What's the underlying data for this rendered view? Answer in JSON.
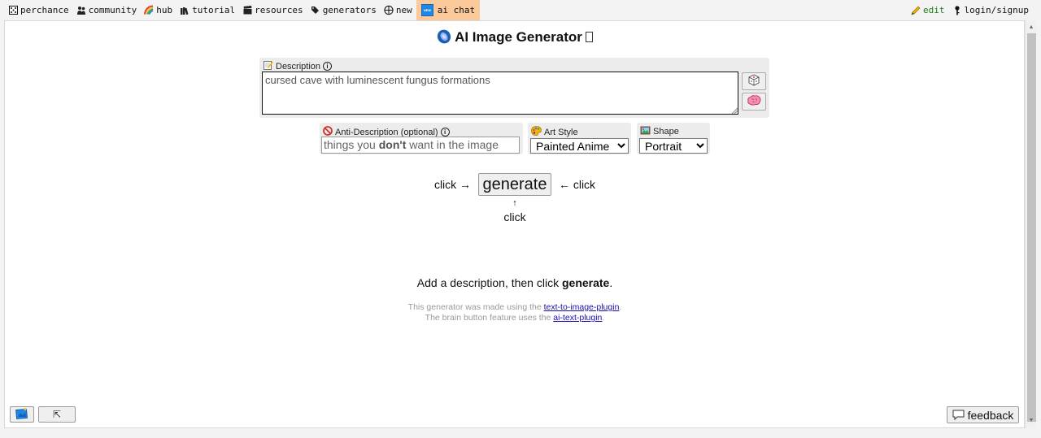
{
  "nav": {
    "left": [
      {
        "icon": "dice-icon",
        "label": "perchance"
      },
      {
        "icon": "community-icon",
        "label": "community"
      },
      {
        "icon": "rainbow-icon",
        "label": "hub"
      },
      {
        "icon": "books-icon",
        "label": "tutorial"
      },
      {
        "icon": "clapper-icon",
        "label": "resources"
      },
      {
        "icon": "tag-icon",
        "label": "generators"
      },
      {
        "icon": "plus-circle-icon",
        "label": "new"
      },
      {
        "icon": "new-badge-icon",
        "label": "ai chat",
        "badge": "NEW"
      }
    ],
    "right": [
      {
        "icon": "pencil-icon",
        "label": "edit"
      },
      {
        "icon": "key-icon",
        "label": "login/signup"
      }
    ],
    "active_color": "#fcc99a"
  },
  "page": {
    "title": "AI Image Generator"
  },
  "description": {
    "label": "Description",
    "info": "i",
    "value": "cursed cave with luminescent fungus formations"
  },
  "anti_description": {
    "label": "Anti-Description (optional)",
    "info": "i",
    "placeholder_before": "things you ",
    "placeholder_bold": "don't",
    "placeholder_after": " want in the image"
  },
  "art_style": {
    "label": "Art Style",
    "selected": "Painted Anime"
  },
  "shape": {
    "label": "Shape",
    "selected": "Portrait"
  },
  "generate": {
    "button_label": "generate",
    "click_left": "click →",
    "click_right": "← click",
    "arrow_up": "↑",
    "click_below": "click"
  },
  "hint": {
    "before": "Add a description, then click ",
    "bold": "generate",
    "after": "."
  },
  "credits": {
    "line1_text": "This generator was made using the ",
    "line1_link": "text-to-image-plugin",
    "line1_end": ".",
    "line2_text": "The brain button feature uses the ",
    "line2_link": "ai-text-plugin",
    "line2_end": "."
  },
  "bottom": {
    "top_arrow": "⇱",
    "feedback_label": "feedback"
  }
}
